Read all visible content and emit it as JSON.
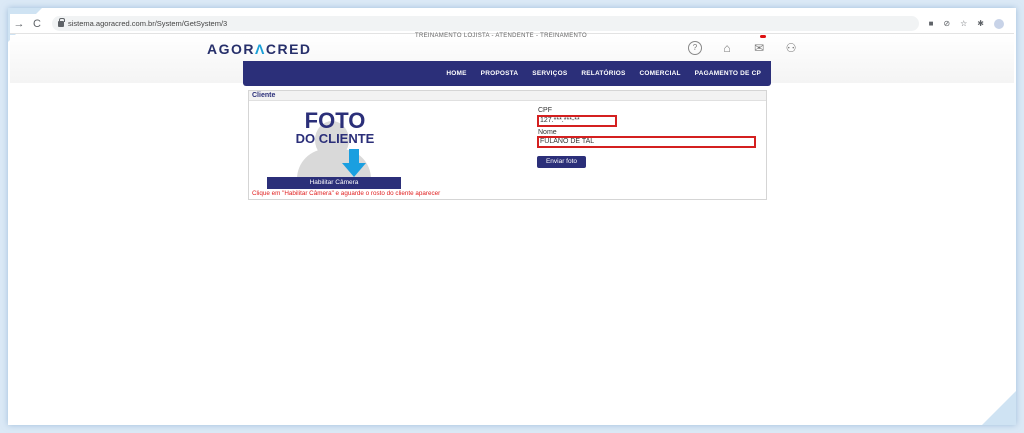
{
  "browser": {
    "url": "sistema.agoracred.com.br/System/GetSystem/3",
    "back_icon": "arrow-left-icon",
    "reload_icon": "reload-icon"
  },
  "header": {
    "logo_text_part1": "AGOR",
    "logo_text_accent": "Λ",
    "logo_text_part2": "CRED",
    "caption": "TREINAMENTO LOJISTA - ATENDENTE - TREINAMENTO",
    "help_symbol": "?",
    "home_symbol": "⌂",
    "mail_symbol": "✉",
    "user_symbol": "⚇"
  },
  "nav": {
    "items": [
      "HOME",
      "PROPOSTA",
      "SERVIÇOS",
      "RELATÓRIOS",
      "COMERCIAL",
      "PAGAMENTO DE CP"
    ]
  },
  "panel": {
    "title": "Cliente",
    "photo_line1": "FOTO",
    "photo_line2": "DO CLIENTE",
    "camera_button": "Habilitar Câmera",
    "camera_hint": "Clique em \"Habilitar Câmera\" e aguarde o rosto do cliente aparecer",
    "cpf_label": "CPF",
    "cpf_value": "127.***.***-**",
    "name_label": "Nome",
    "name_value": "FULANO DE TAL",
    "send_button": "Enviar foto"
  },
  "colors": {
    "brand": "#2b2f79",
    "accent": "#1aa0d8",
    "error": "#d42020"
  }
}
